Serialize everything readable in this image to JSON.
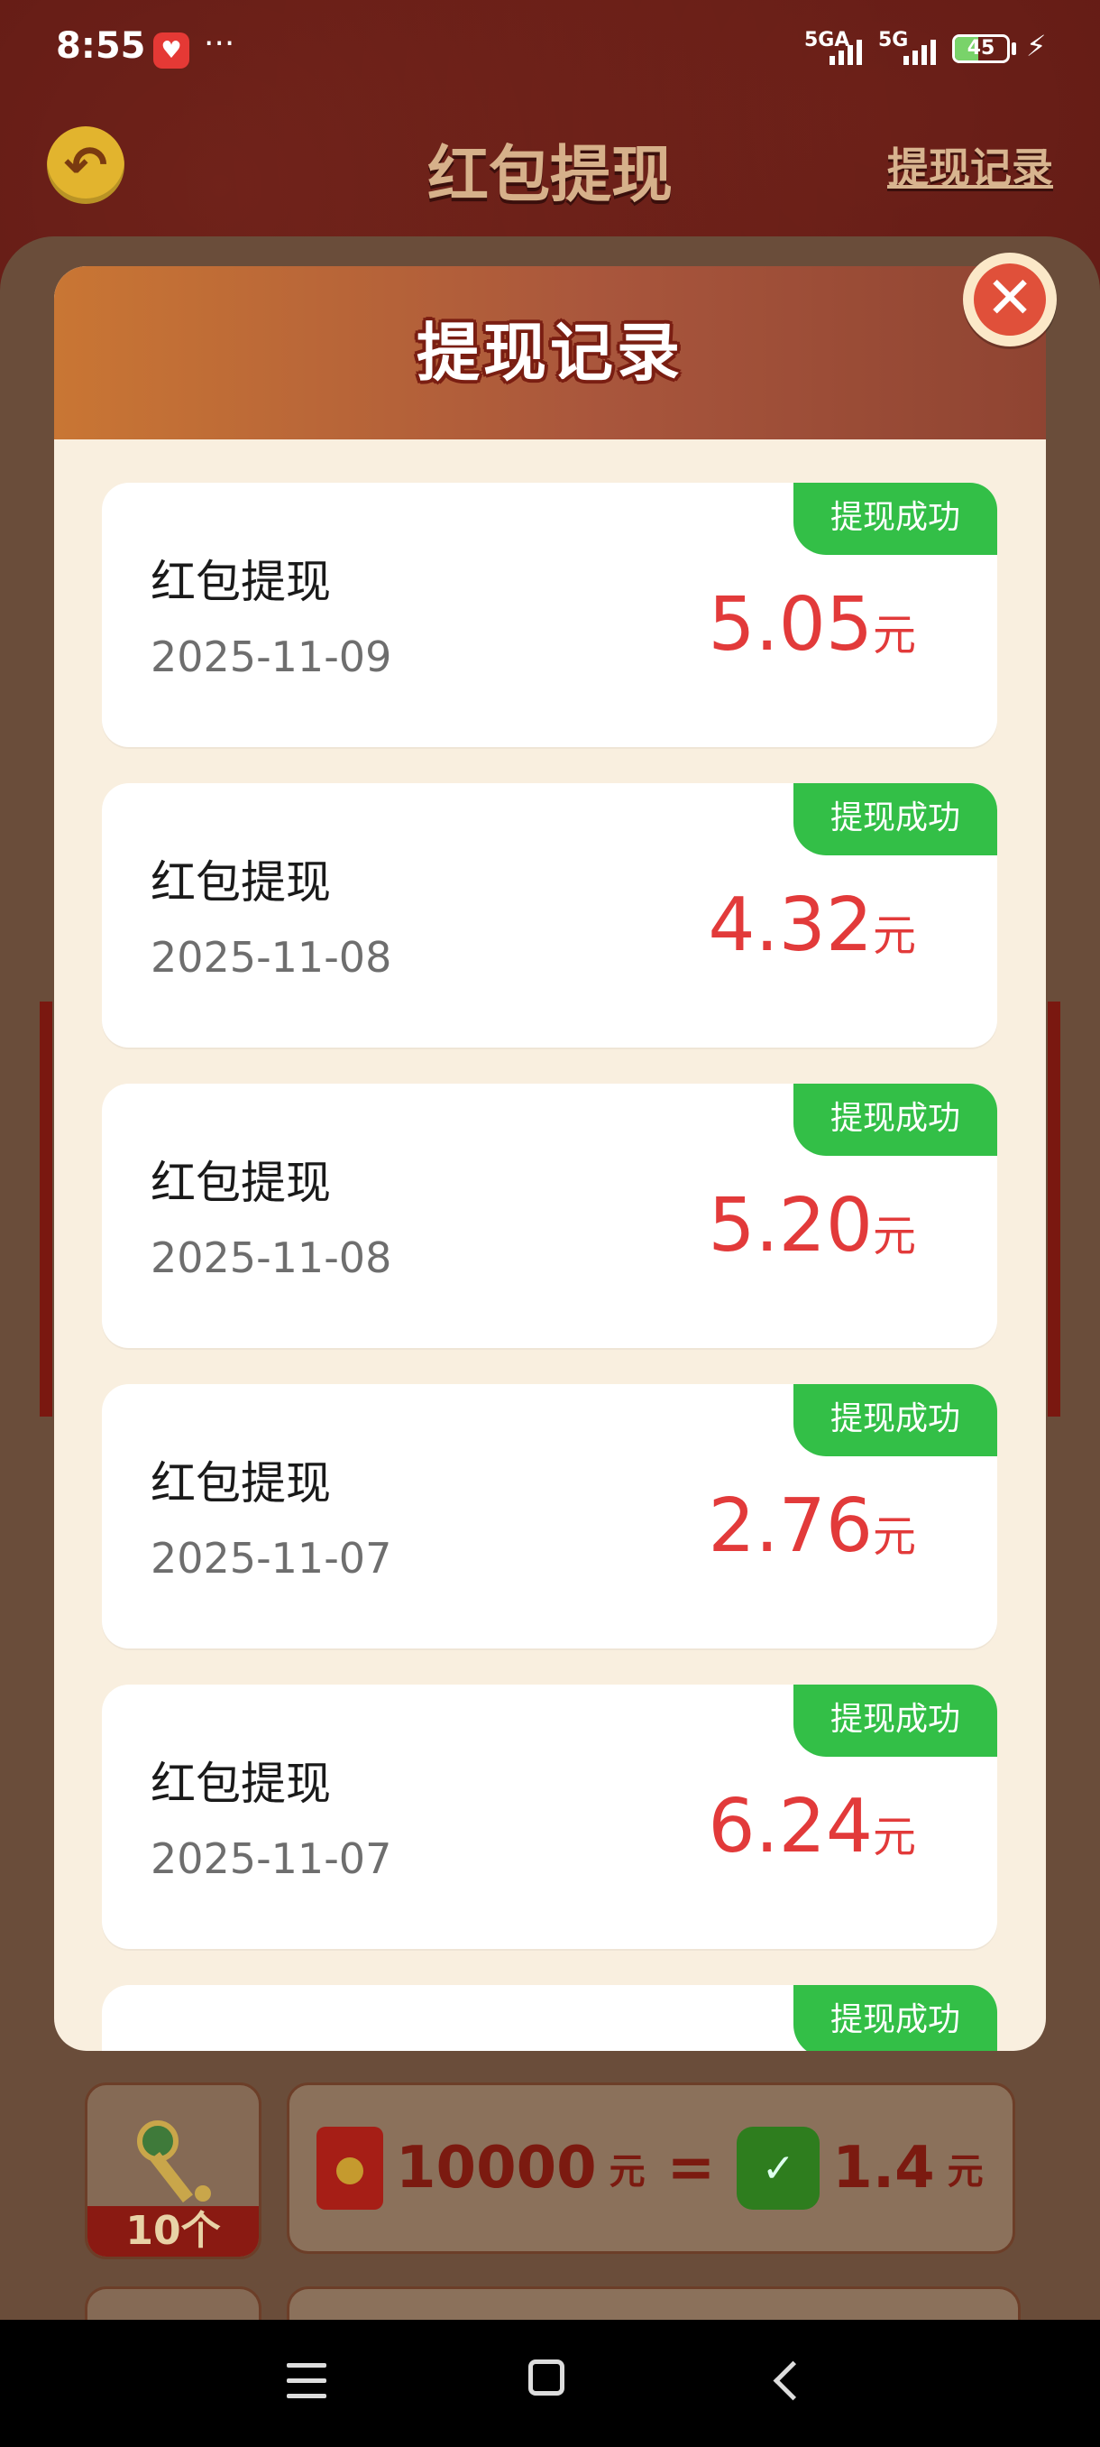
{
  "status_bar": {
    "time": "8:55",
    "more": "···",
    "signal_1": "5GA",
    "signal_2": "5G",
    "battery": "45"
  },
  "page": {
    "title": "红包提现",
    "record_link": "提现记录",
    "item_count": "10个",
    "rate_amount": "10000",
    "rate_unit": "元",
    "rate_equals": "=",
    "rate_value": "1.4",
    "rate_value_unit": "元"
  },
  "modal": {
    "title": "提现记录",
    "close_label": "✕",
    "records": [
      {
        "name": "红包提现",
        "date": "2025-11-09",
        "amount": "5.05",
        "unit": "元",
        "status": "提现成功"
      },
      {
        "name": "红包提现",
        "date": "2025-11-08",
        "amount": "4.32",
        "unit": "元",
        "status": "提现成功"
      },
      {
        "name": "红包提现",
        "date": "2025-11-08",
        "amount": "5.20",
        "unit": "元",
        "status": "提现成功"
      },
      {
        "name": "红包提现",
        "date": "2025-11-07",
        "amount": "2.76",
        "unit": "元",
        "status": "提现成功"
      },
      {
        "name": "红包提现",
        "date": "2025-11-07",
        "amount": "6.24",
        "unit": "元",
        "status": "提现成功"
      },
      {
        "status": "提现成功"
      }
    ]
  },
  "colors": {
    "status_green": "#33bf47",
    "amount_red": "#e23a3a",
    "modal_bg": "#f9efdf"
  }
}
